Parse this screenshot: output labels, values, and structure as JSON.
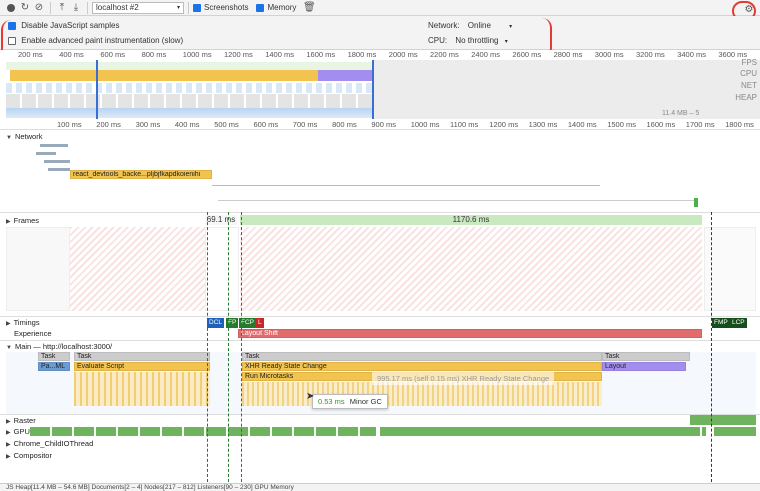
{
  "toolbar": {
    "target": "localhost #2",
    "screenshots_label": "Screenshots",
    "memory_label": "Memory"
  },
  "settings": {
    "disable_js_samples": "Disable JavaScript samples",
    "advanced_paint": "Enable advanced paint instrumentation (slow)",
    "network_label": "Network:",
    "network_value": "Online",
    "cpu_label": "CPU:",
    "cpu_value": "No throttling"
  },
  "overview": {
    "ticks_top": [
      "200 ms",
      "400 ms",
      "600 ms",
      "800 ms",
      "1000 ms",
      "1200 ms",
      "1400 ms",
      "1600 ms",
      "1800 ms",
      "2000 ms",
      "2200 ms",
      "2400 ms",
      "2600 ms",
      "2800 ms",
      "3000 ms",
      "3200 ms",
      "3400 ms",
      "3600 ms"
    ],
    "track_labels": [
      "FPS",
      "CPU",
      "NET",
      "HEAP"
    ],
    "heap_value": "11.4 MB – 5"
  },
  "ruler": {
    "ticks": [
      "100 ms",
      "200 ms",
      "300 ms",
      "400 ms",
      "500 ms",
      "600 ms",
      "700 ms",
      "800 ms",
      "900 ms",
      "1000 ms",
      "1100 ms",
      "1200 ms",
      "1300 ms",
      "1400 ms",
      "1500 ms",
      "1600 ms",
      "1700 ms",
      "1800 ms",
      "1900 ms"
    ]
  },
  "network": {
    "title": "Network",
    "request_label": "react_devtools_backe...pljbjfkapdkoienihi"
  },
  "frames": {
    "title": "Frames",
    "frame1": "69.1 ms",
    "frame2": "1170.6 ms"
  },
  "timings": {
    "title": "Timings",
    "dcl": "DCL",
    "fp": "FP",
    "fcp": "FCP",
    "l": "L",
    "fmp": "FMP",
    "lcp": "LCP"
  },
  "experience": {
    "title": "Experience",
    "layout_shift": "Layout Shift"
  },
  "main": {
    "title": "Main — http://localhost:3000/",
    "task1": "Task",
    "task2": "Task",
    "task3": "Task",
    "task4": "Task",
    "parse": "Pa...ML",
    "evaluate": "Evaluate Script",
    "xhr": "XHR Ready State Change",
    "microtasks": "Run Microtasks",
    "layout": "Layout",
    "hover_tip": "995.17 ms (self 0.15 ms) XHR Ready State Change",
    "gc_time": "0.53 ms",
    "gc_label": "Minor GC"
  },
  "tracks": {
    "raster": "Raster",
    "gpu": "GPU",
    "chrome_child": "Chrome_ChildIOThread",
    "compositor": "Compositor"
  },
  "footer": {
    "text": "JS Heap[11.4 MB – 54.6 MB]   Documents[2 – 4]   Nodes[217 – 812]   Listeners[90 – 230]   GPU Memory"
  },
  "colors": {
    "scripting": "#f2c34e",
    "rendering": "#a38ef0",
    "painting": "#6fb35f",
    "frame_green": "#c9e9c0",
    "experience_red": "#e26b6b"
  }
}
